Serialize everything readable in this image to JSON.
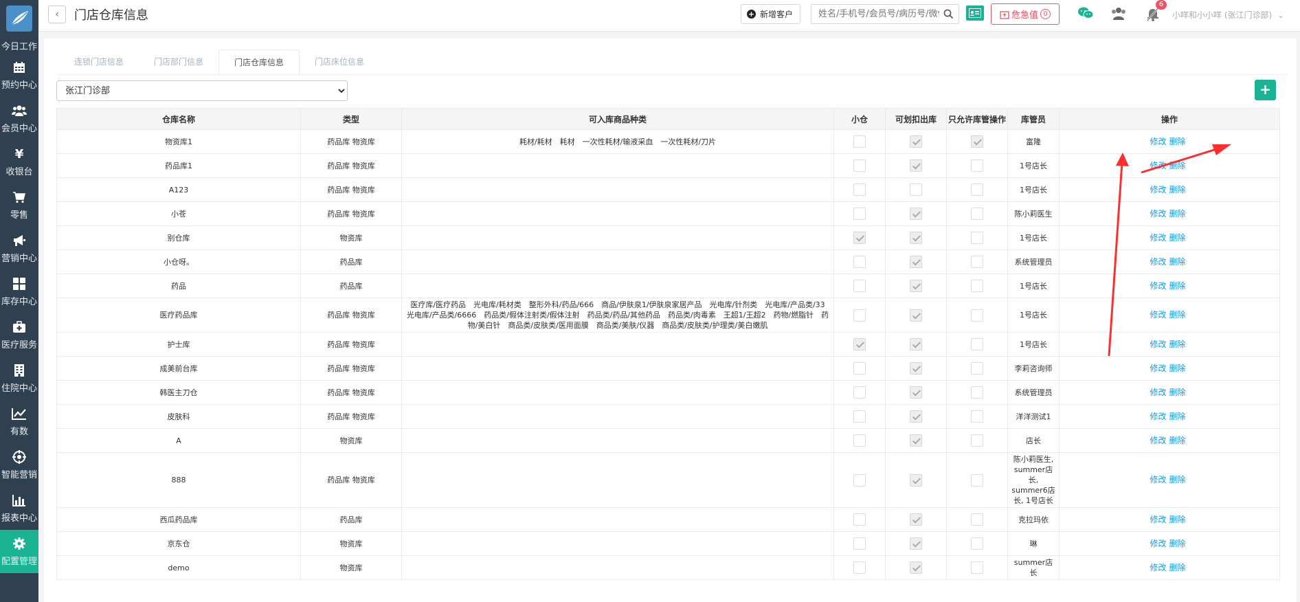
{
  "sidebar": {
    "items": [
      {
        "label": "今日工作",
        "icon": "none"
      },
      {
        "label": "预约中心",
        "icon": "calendar-icon"
      },
      {
        "label": "会员中心",
        "icon": "users-icon"
      },
      {
        "label": "收银台",
        "icon": "yen-icon"
      },
      {
        "label": "零售",
        "icon": "cart-icon"
      },
      {
        "label": "营销中心",
        "icon": "bullhorn-icon"
      },
      {
        "label": "库存中心",
        "icon": "grid-icon"
      },
      {
        "label": "医疗服务",
        "icon": "medkit-icon"
      },
      {
        "label": "住院中心",
        "icon": "building-icon"
      },
      {
        "label": "有数",
        "icon": "line-chart-icon"
      },
      {
        "label": "智能营销",
        "icon": "target-icon"
      },
      {
        "label": "报表中心",
        "icon": "bar-chart-icon"
      },
      {
        "label": "配置管理",
        "icon": "gear-icon"
      }
    ],
    "active_index": 12
  },
  "header": {
    "back": "‹",
    "title": "门店仓库信息",
    "new_customer": "新增客户",
    "search_placeholder": "姓名/手机号/会员号/病历号/微信号",
    "danger_label": "危急值",
    "danger_count": "0",
    "notification_count": "6",
    "user": "小咩和小小咩 (张江门诊部)"
  },
  "tabs": [
    "连锁门店信息",
    "门店部门信息",
    "门店仓库信息",
    "门店床位信息"
  ],
  "active_tab": 2,
  "store_select": "张江门诊部",
  "add_label": "+",
  "table": {
    "headers": [
      "仓库名称",
      "类型",
      "可入库商品种类",
      "小仓",
      "可划扣出库",
      "只允许库管操作",
      "库管员",
      "操作"
    ],
    "edit_label": "修改",
    "delete_label": "删除",
    "rows": [
      {
        "name": "物资库1",
        "type": "药品库 物资库",
        "cats": "耗材/耗材　耗材　一次性耗材/输液采血　一次性耗材/刀片",
        "small": false,
        "deduct": true,
        "admin_only": true,
        "keeper": "富隆"
      },
      {
        "name": "药品库1",
        "type": "药品库 物资库",
        "cats": "",
        "small": false,
        "deduct": true,
        "admin_only": false,
        "keeper": "1号店长"
      },
      {
        "name": "A123",
        "type": "药品库 物资库",
        "cats": "",
        "small": false,
        "deduct": false,
        "admin_only": false,
        "keeper": "1号店长"
      },
      {
        "name": "小苍",
        "type": "药品库 物资库",
        "cats": "",
        "small": false,
        "deduct": true,
        "admin_only": false,
        "keeper": "陈小莉医生"
      },
      {
        "name": "别仓库",
        "type": "物资库",
        "cats": "",
        "small": true,
        "deduct": true,
        "admin_only": false,
        "keeper": "1号店长"
      },
      {
        "name": "小仓呀。",
        "type": "药品库",
        "cats": "",
        "small": false,
        "deduct": true,
        "admin_only": false,
        "keeper": "系统管理员"
      },
      {
        "name": "药品",
        "type": "药品库",
        "cats": "",
        "small": false,
        "deduct": true,
        "admin_only": false,
        "keeper": "1号店长"
      },
      {
        "name": "医疗药品库",
        "type": "药品库 物资库",
        "cats": "医疗库/医疗药品　光电库/耗材类　整形外科/药品/666　商品/伊肤泉1/伊肤泉家居产品　光电库/针剂类　光电库/产品类/33　光电库/产品类/6666　药品类/假体注射类/假体注射　药品类/药品/其他药品　药品类/肉毒素　王超1/王超2　药物/燃脂针　药物/美白针　商品类/皮肤类/医用面膜　商品类/美肤/仪器　商品类/皮肤类/护理类/美白嫩肌",
        "small": false,
        "deduct": true,
        "admin_only": false,
        "keeper": "1号店长"
      },
      {
        "name": "护士库",
        "type": "药品库 物资库",
        "cats": "",
        "small": true,
        "deduct": true,
        "admin_only": false,
        "keeper": "1号店长"
      },
      {
        "name": "成美前台库",
        "type": "药品库 物资库",
        "cats": "",
        "small": false,
        "deduct": true,
        "admin_only": false,
        "keeper": "李莉咨询师"
      },
      {
        "name": "韩医主刀仓",
        "type": "药品库 物资库",
        "cats": "",
        "small": false,
        "deduct": true,
        "admin_only": false,
        "keeper": "系统管理员"
      },
      {
        "name": "皮肤科",
        "type": "药品库 物资库",
        "cats": "",
        "small": false,
        "deduct": true,
        "admin_only": false,
        "keeper": "洋洋测试1"
      },
      {
        "name": "A",
        "type": "物资库",
        "cats": "",
        "small": false,
        "deduct": true,
        "admin_only": false,
        "keeper": "店长"
      },
      {
        "name": "888",
        "type": "药品库 物资库",
        "cats": "",
        "small": false,
        "deduct": true,
        "admin_only": false,
        "keeper": "陈小莉医生, summer店长, summer6店长, 1号店长"
      },
      {
        "name": "西瓜药品库",
        "type": "药品库",
        "cats": "",
        "small": false,
        "deduct": true,
        "admin_only": false,
        "keeper": "克拉玛依"
      },
      {
        "name": "京东仓",
        "type": "物资库",
        "cats": "",
        "small": false,
        "deduct": true,
        "admin_only": false,
        "keeper": "琳"
      },
      {
        "name": "demo",
        "type": "物资库",
        "cats": "",
        "small": false,
        "deduct": true,
        "admin_only": false,
        "keeper": "summer店长"
      }
    ]
  },
  "colors": {
    "sidebar": "#2f4050",
    "accent": "#1ab394",
    "danger": "#ed5565",
    "link": "#0e9aef",
    "annotation": "#ff2d2d"
  }
}
